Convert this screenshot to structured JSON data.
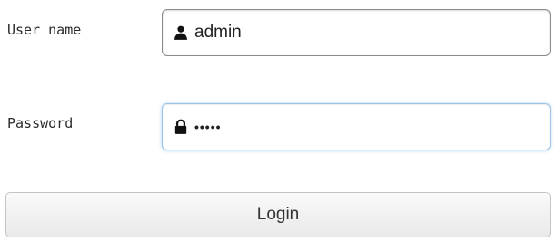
{
  "form": {
    "username_label": "User name",
    "username_value": "admin",
    "username_icon": "user-icon",
    "password_label": "Password",
    "password_value": "•••••",
    "password_icon": "lock-icon",
    "login_label": "Login",
    "focus_color": "#66afe9"
  }
}
